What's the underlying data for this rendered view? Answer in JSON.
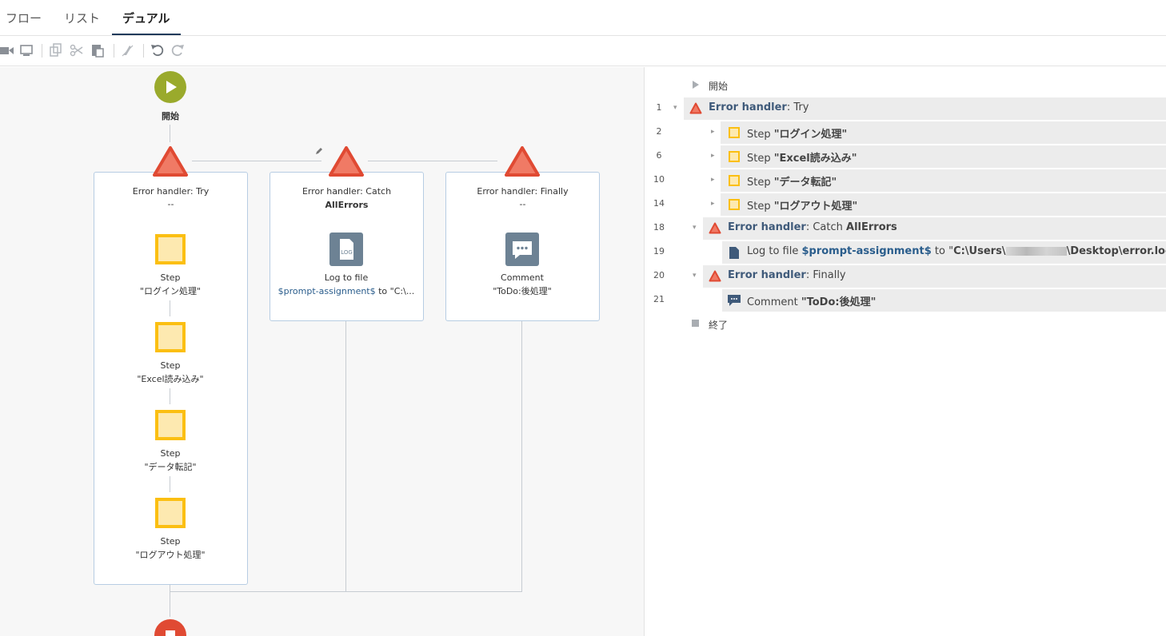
{
  "tabs": [
    "フロー",
    "リスト",
    "デュアル"
  ],
  "toolbar": {
    "icons": [
      "record-icon",
      "screen-icon",
      "copy-icon",
      "cut-icon",
      "paste-icon",
      "disable-icon",
      "undo-icon",
      "redo-icon"
    ]
  },
  "flow": {
    "start_label": "開始",
    "try_card": {
      "title": "Error handler: Try",
      "sub": "--"
    },
    "catch_card": {
      "title": "Error handler: Catch",
      "sub": "AllErrors",
      "node_label": "Log to file",
      "node_detail_var": "$prompt-assignment$",
      "node_detail_rest": " to \"C:\\..."
    },
    "finally_card": {
      "title": "Error handler: Finally",
      "sub": "--",
      "node_label": "Comment",
      "node_detail": "\"ToDo:後処理\""
    },
    "steps": [
      {
        "label": "Step",
        "detail": "\"ログイン処理\""
      },
      {
        "label": "Step",
        "detail": "\"Excel読み込み\""
      },
      {
        "label": "Step",
        "detail": "\"データ転記\""
      },
      {
        "label": "Step",
        "detail": "\"ログアウト処理\""
      }
    ],
    "log_icon_text": "LOG"
  },
  "list": {
    "start": "開始",
    "end": "終了",
    "rows": [
      {
        "num": "1",
        "prefix": "Error handler",
        "rest": ": Try",
        "bold": ""
      },
      {
        "num": "2",
        "prefix": "Step ",
        "rest": "\"ログイン処理\""
      },
      {
        "num": "6",
        "prefix": "Step ",
        "rest": "\"Excel読み込み\""
      },
      {
        "num": "10",
        "prefix": "Step ",
        "rest": "\"データ転記\""
      },
      {
        "num": "14",
        "prefix": "Step ",
        "rest": "\"ログアウト処理\""
      },
      {
        "num": "18",
        "prefix": "Error handler",
        "rest": ": Catch ",
        "bold": "AllErrors"
      },
      {
        "num": "19",
        "prefix": "Log to file ",
        "var": "$prompt-assignment$",
        "mid": " to \"",
        "path1": "C:\\Users\\",
        "path2": "\\Desktop\\error.log",
        "end": "\""
      },
      {
        "num": "20",
        "prefix": "Error handler",
        "rest": ": Finally",
        "bold": ""
      },
      {
        "num": "21",
        "prefix": "Comment ",
        "rest": "\"ToDo:後処理\""
      }
    ]
  },
  "colors": {
    "accent": "#1f3a5a",
    "error_red": "#e8533a",
    "step_yellow": "#fbbf12",
    "start_green": "#9aaa2c"
  }
}
